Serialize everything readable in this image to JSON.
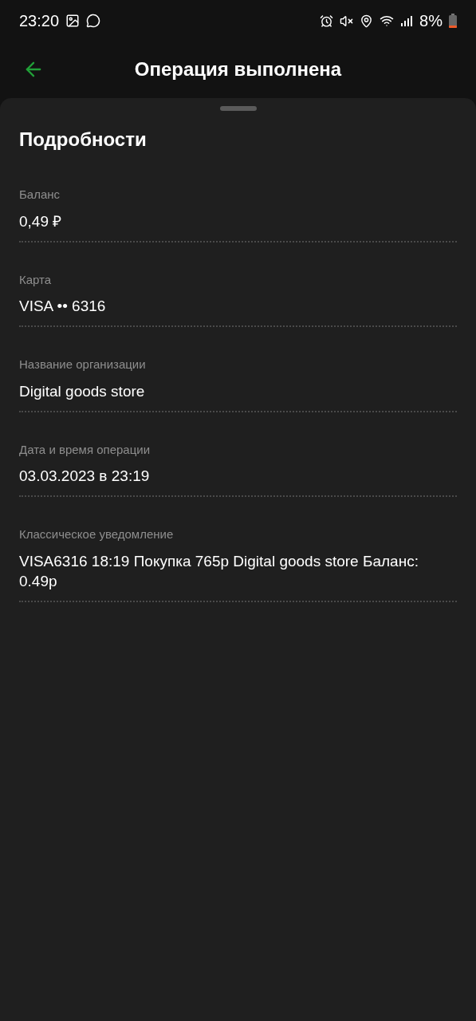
{
  "status_bar": {
    "time": "23:20",
    "battery_text": "8%"
  },
  "header": {
    "title": "Операция выполнена"
  },
  "details": {
    "title": "Подробности",
    "fields": [
      {
        "label": "Баланс",
        "value": "0,49 ₽"
      },
      {
        "label": "Карта",
        "value": "VISA •• 6316"
      },
      {
        "label": "Название организации",
        "value": "Digital goods store"
      },
      {
        "label": "Дата и время операции",
        "value": "03.03.2023 в 23:19"
      },
      {
        "label": "Классическое уведомление",
        "value": "VISA6316 18:19 Покупка 765р Digital goods store Баланс: 0.49р"
      }
    ]
  }
}
